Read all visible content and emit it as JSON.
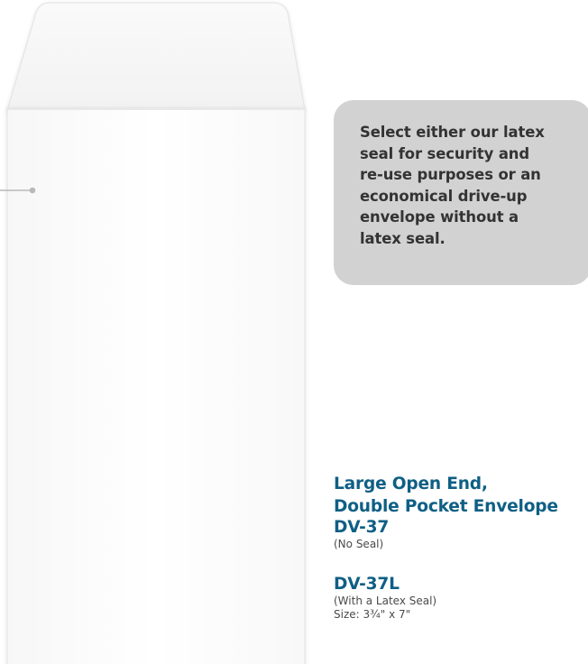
{
  "callout": {
    "lines": [
      "Select either our latex",
      "seal for security and",
      "re-use purposes or an",
      "economical drive-up",
      "envelope without a",
      "latex seal."
    ]
  },
  "product": {
    "title_lines": [
      "Large Open End,",
      "Double Pocket Envelope"
    ],
    "models": [
      {
        "code": "DV-37",
        "notes": [
          "(No Seal)"
        ]
      },
      {
        "code": "DV-37L",
        "notes": [
          "(With a Latex Seal)",
          "Size: 3¾\" x 7\""
        ]
      }
    ]
  },
  "colors": {
    "title_blue": "#0f5f85",
    "callout_bg": "#d2d2d2",
    "callout_text": "#333333",
    "note_text": "#4a4a4a"
  },
  "icons": {
    "seal_marker": "line-with-dot-marker"
  }
}
